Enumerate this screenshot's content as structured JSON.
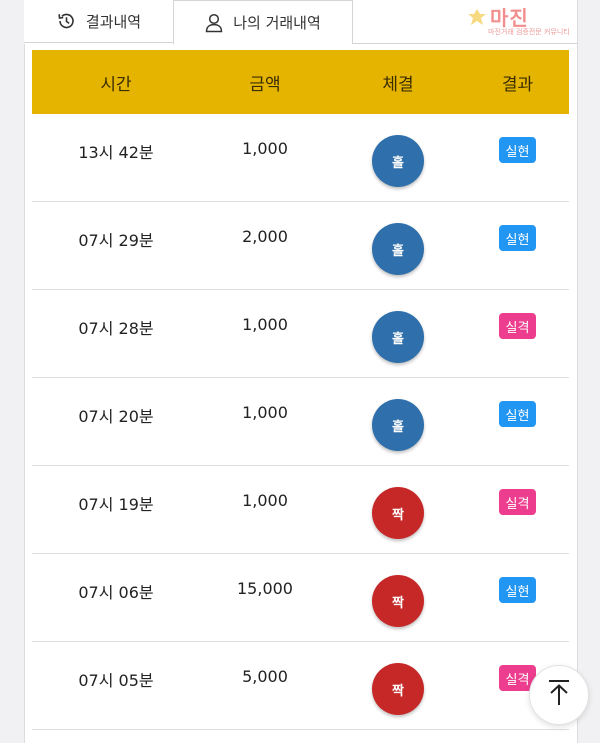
{
  "tabs": [
    {
      "label": "결과내역",
      "icon": "history-icon",
      "active": false
    },
    {
      "label": "나의 거래내역",
      "icon": "user-icon",
      "active": true
    }
  ],
  "watermark": {
    "text": "마진",
    "subtext": "마진거래 검증전문 커뮤니티"
  },
  "table": {
    "headers": [
      "시간",
      "금액",
      "체결",
      "결과"
    ],
    "rows": [
      {
        "time": "13시 42분",
        "amount": "1,000",
        "fill": "홀",
        "result": "실현"
      },
      {
        "time": "07시 29분",
        "amount": "2,000",
        "fill": "홀",
        "result": "실현"
      },
      {
        "time": "07시 28분",
        "amount": "1,000",
        "fill": "홀",
        "result": "실격"
      },
      {
        "time": "07시 20분",
        "amount": "1,000",
        "fill": "홀",
        "result": "실현"
      },
      {
        "time": "07시 19분",
        "amount": "1,000",
        "fill": "짝",
        "result": "실격"
      },
      {
        "time": "07시 06분",
        "amount": "15,000",
        "fill": "짝",
        "result": "실현"
      },
      {
        "time": "07시 05분",
        "amount": "5,000",
        "fill": "짝",
        "result": "실격"
      }
    ]
  },
  "colors": {
    "header_bg": "#e5b400",
    "ball_hol": "#2f6fab",
    "ball_jjak": "#c62828",
    "badge_success": "#2196f3",
    "badge_fail": "#ec3d8e"
  }
}
